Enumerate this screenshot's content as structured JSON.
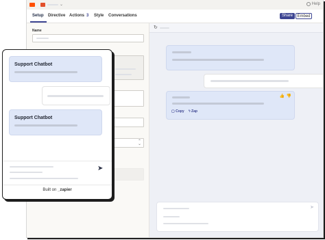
{
  "topbar": {
    "help_label": "Help",
    "chevron": "⌄"
  },
  "tabs": [
    {
      "label": "Setup",
      "active": true
    },
    {
      "label": "Directive",
      "active": false
    },
    {
      "label": "Actions",
      "count": "3",
      "active": false
    },
    {
      "label": "Style",
      "active": false
    },
    {
      "label": "Conversations",
      "active": false
    }
  ],
  "buttons": {
    "share": "Share",
    "embed": "Embed"
  },
  "setup": {
    "name_label": "Name"
  },
  "preview": {
    "copy_label": "Copy",
    "zap_label": "Zap",
    "send_glyph": "➤",
    "refresh_glyph": "↻"
  },
  "chatbot": {
    "title_1": "Support Chatbot",
    "title_2": "Support Chatbot",
    "send_glyph": "➤",
    "built_on": "Built on",
    "brand": "_zapier"
  },
  "colors": {
    "accent": "#3d4592",
    "brand": "#ff4f00",
    "bot_bubble": "#dfe7f8"
  }
}
